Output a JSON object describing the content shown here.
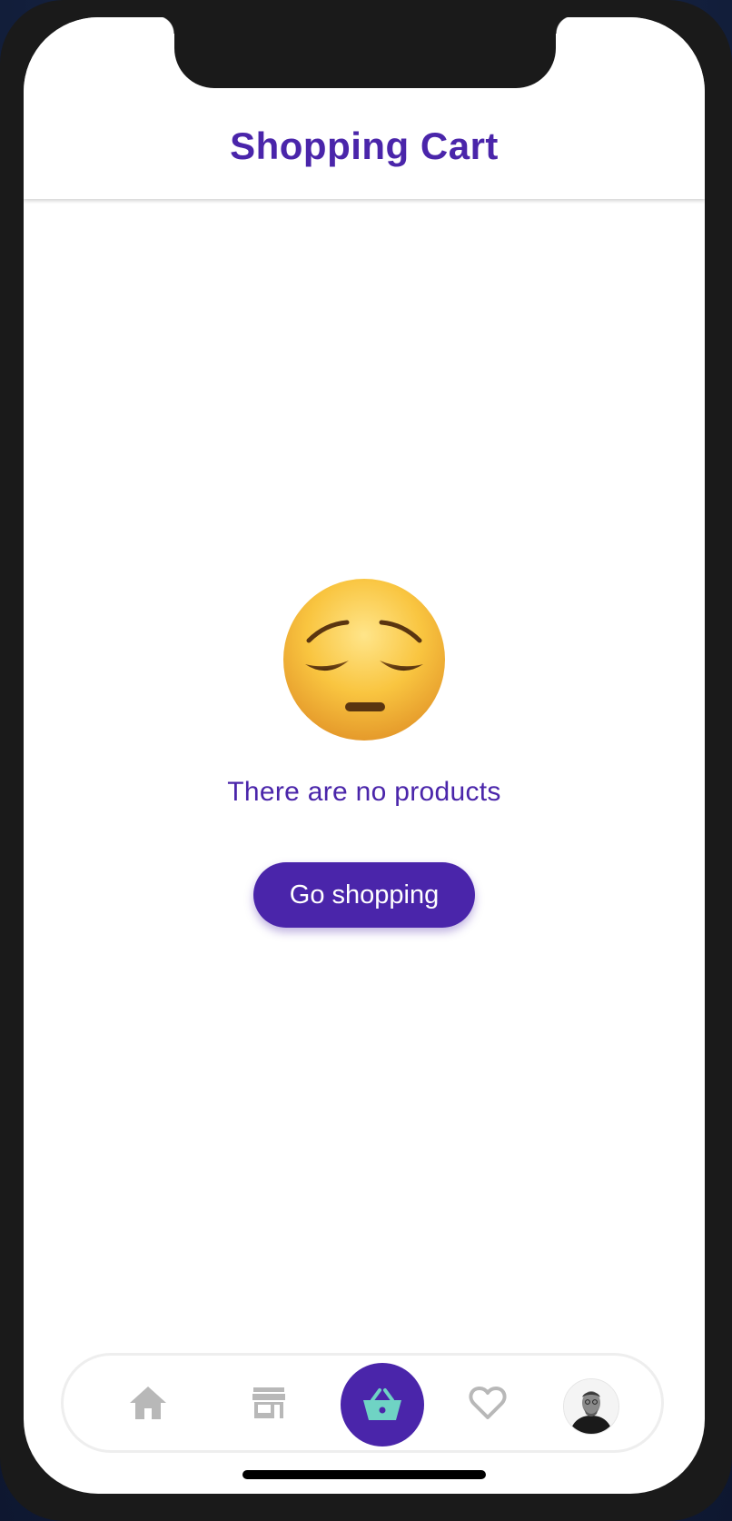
{
  "header": {
    "title": "Shopping Cart"
  },
  "empty_state": {
    "emoji": "pensive-face",
    "message": "There are no products",
    "button_label": "Go shopping"
  },
  "bottom_nav": {
    "items": [
      {
        "name": "home",
        "icon": "home-icon",
        "active": false
      },
      {
        "name": "store",
        "icon": "store-icon",
        "active": false
      },
      {
        "name": "cart",
        "icon": "basket-icon",
        "active": true
      },
      {
        "name": "favorites",
        "icon": "heart-icon",
        "active": false
      },
      {
        "name": "profile",
        "icon": "avatar",
        "active": false
      }
    ]
  },
  "colors": {
    "primary": "#4a25aa",
    "basket_accent": "#6fd3c4",
    "inactive_icon": "#b8b8b8",
    "background": "#ffffff"
  }
}
